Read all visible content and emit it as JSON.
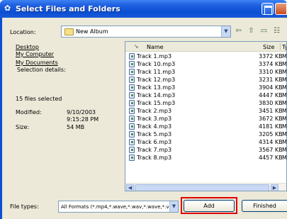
{
  "window": {
    "title": "Select Files and Folders"
  },
  "location": {
    "label": "Location:",
    "value": "New Album"
  },
  "left_pane": {
    "links": [
      "Desktop",
      "My Computer",
      "My Documents"
    ],
    "selection_label": "Selection details:",
    "files_selected": "15 files selected",
    "modified_label": "Modified:",
    "modified_date": "9/10/2003",
    "modified_time": "9:15:28 PM",
    "size_label": "Size:",
    "size_value": "54 MB"
  },
  "file_list": {
    "headers": {
      "name": "Name",
      "size": "Size",
      "type": "Ty"
    },
    "rows": [
      {
        "name": "Track 1.mp3",
        "size": "3372 KB",
        "type": "MI"
      },
      {
        "name": "Track 10.mp3",
        "size": "3374 KB",
        "type": "MI"
      },
      {
        "name": "Track 11.mp3",
        "size": "3310 KB",
        "type": "MI"
      },
      {
        "name": "Track 12.mp3",
        "size": "3231 KB",
        "type": "MI"
      },
      {
        "name": "Track 13.mp3",
        "size": "3904 KB",
        "type": "MI"
      },
      {
        "name": "Track 14.mp3",
        "size": "4447 KB",
        "type": "MI"
      },
      {
        "name": "Track 15.mp3",
        "size": "3830 KB",
        "type": "MI"
      },
      {
        "name": "Track 2.mp3",
        "size": "3451 KB",
        "type": "MI"
      },
      {
        "name": "Track 3.mp3",
        "size": "3672 KB",
        "type": "MI"
      },
      {
        "name": "Track 4.mp3",
        "size": "4181 KB",
        "type": "MI"
      },
      {
        "name": "Track 5.mp3",
        "size": "3205 KB",
        "type": "MI"
      },
      {
        "name": "Track 6.mp3",
        "size": "4314 KB",
        "type": "MI"
      },
      {
        "name": "Track 7.mp3",
        "size": "3567 KB",
        "type": "MI"
      },
      {
        "name": "Track 8.mp3",
        "size": "4457 KB",
        "type": "MI"
      }
    ]
  },
  "file_types": {
    "label": "File types:",
    "value": "All Formats (*.mp4,*.wave,*.wav,*.wave,*.v"
  },
  "buttons": {
    "add": "Add",
    "finished": "Finished"
  },
  "colors": {
    "titlebar": "#0a4fd4",
    "highlight": "#e00000",
    "dialog_bg": "#ece9d8"
  }
}
